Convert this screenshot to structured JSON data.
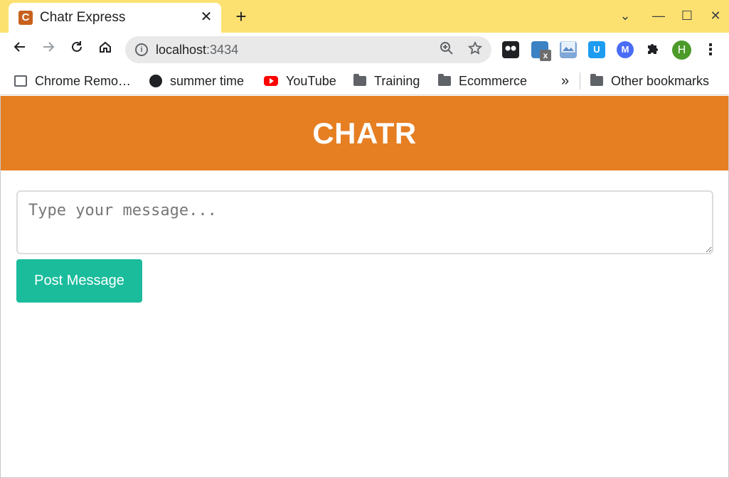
{
  "browser": {
    "tab": {
      "favicon_letter": "C",
      "title": "Chatr Express",
      "close_glyph": "✕"
    },
    "new_tab_glyph": "+",
    "window_controls": {
      "tab_search": "⌄",
      "minimize": "—",
      "maximize": "☐",
      "close": "✕"
    },
    "omnibox": {
      "host": "localhost",
      "port": ":3434"
    },
    "avatar_letter": "H",
    "extensions": [
      {
        "name": "tampermonkey-icon",
        "color": "#202124"
      },
      {
        "name": "screen-capture-x-icon",
        "color": "#3b82c4"
      },
      {
        "name": "image-extension-icon",
        "color": "#7fa7d8"
      },
      {
        "name": "u-extension-icon",
        "color": "#1e9cf0"
      },
      {
        "name": "m-extension-icon",
        "color": "#4a6cf7"
      }
    ]
  },
  "bookmarks": {
    "items": [
      {
        "label": "Chrome Remo…",
        "icon": "remote-desktop-icon"
      },
      {
        "label": "summer time",
        "icon": "globe-icon"
      },
      {
        "label": "YouTube",
        "icon": "youtube-icon"
      },
      {
        "label": "Training",
        "icon": "folder-icon"
      },
      {
        "label": "Ecommerce",
        "icon": "folder-icon"
      }
    ],
    "more_glyph": "»",
    "other": {
      "label": "Other bookmarks",
      "icon": "folder-icon"
    }
  },
  "app": {
    "title": "CHATR",
    "header_color": "#e67e22",
    "message_placeholder": "Type your message...",
    "post_button_label": "Post Message",
    "button_color": "#1abc9c"
  }
}
